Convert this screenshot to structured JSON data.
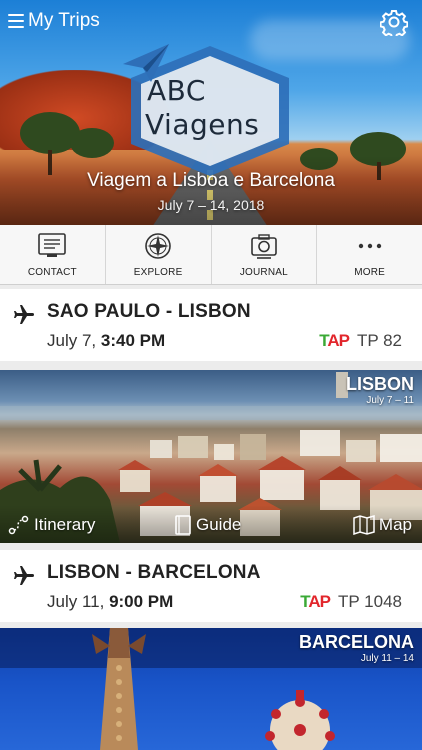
{
  "header": {
    "title": "My Trips",
    "menu_icon": "hamburger-menu-icon",
    "settings_icon": "gear-icon"
  },
  "hero": {
    "logo_line1": "ABC",
    "logo_line2": "Viagens",
    "trip_name": "Viagem a Lisboa e Barcelona",
    "trip_dates": "July 7 – 14, 2018"
  },
  "actions": [
    {
      "label": "CONTACT",
      "icon": "contact-card-icon"
    },
    {
      "label": "EXPLORE",
      "icon": "compass-icon"
    },
    {
      "label": "JOURNAL",
      "icon": "camera-icon"
    },
    {
      "label": "MORE",
      "icon": "more-dots-icon"
    }
  ],
  "flights": [
    {
      "route": "SAO PAULO - LISBON",
      "date": "July 7,",
      "time": "3:40 PM",
      "airline_logo": "TAP",
      "flight_number": "TP 82"
    },
    {
      "route": "LISBON - BARCELONA",
      "date": "July 11,",
      "time": "9:00 PM",
      "airline_logo": "TAP",
      "flight_number": "TP 1048"
    }
  ],
  "destinations": [
    {
      "name": "LISBON",
      "dates": "July 7 – 11",
      "itinerary": "Itinerary",
      "guide": "Guide",
      "map": "Map"
    },
    {
      "name": "BARCELONA",
      "dates": "July 11 – 14"
    }
  ],
  "colors": {
    "tap_green": "#3aa935",
    "tap_red": "#e2262c",
    "badge_blue": "#2e6fb8"
  }
}
